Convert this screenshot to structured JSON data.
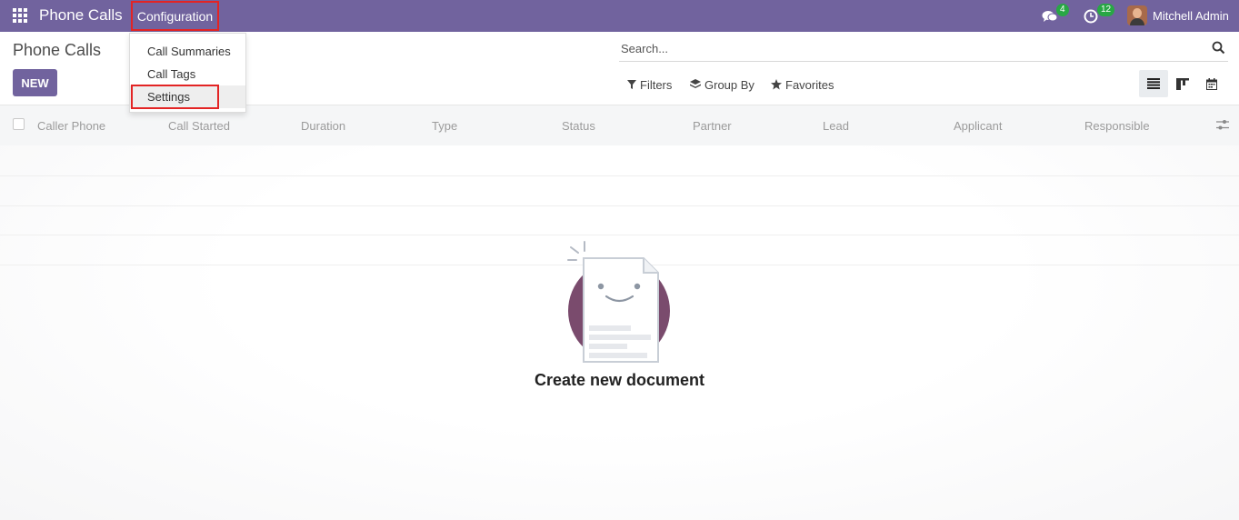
{
  "navbar": {
    "app_title": "Phone Calls",
    "menu_configuration": "Configuration",
    "messages_count": "4",
    "activities_count": "12",
    "user_name": "Mitchell Admin",
    "bg_color": "#71639e"
  },
  "dropdown": {
    "items": [
      "Call Summaries",
      "Call Tags",
      "Settings"
    ]
  },
  "control_panel": {
    "breadcrumb": "Phone Calls",
    "new_label": "NEW",
    "search_placeholder": "Search...",
    "filters_label": "Filters",
    "group_by_label": "Group By",
    "favorites_label": "Favorites"
  },
  "table": {
    "columns": [
      "Caller Phone",
      "Call Started",
      "Duration",
      "Type",
      "Status",
      "Partner",
      "Lead",
      "Applicant",
      "Responsible"
    ]
  },
  "empty_state": {
    "title": "Create new document"
  },
  "colors": {
    "primary": "#71639e",
    "highlight_border": "#e32424",
    "badge": "#28a745",
    "helper_circle": "#7a4b6d"
  },
  "icons": [
    "apps-grid-icon",
    "chat-icon",
    "clock-icon",
    "search-icon",
    "filter-icon",
    "layers-icon",
    "star-icon",
    "list-view-icon",
    "kanban-view-icon",
    "calendar-view-icon",
    "settings-sliders-icon"
  ]
}
